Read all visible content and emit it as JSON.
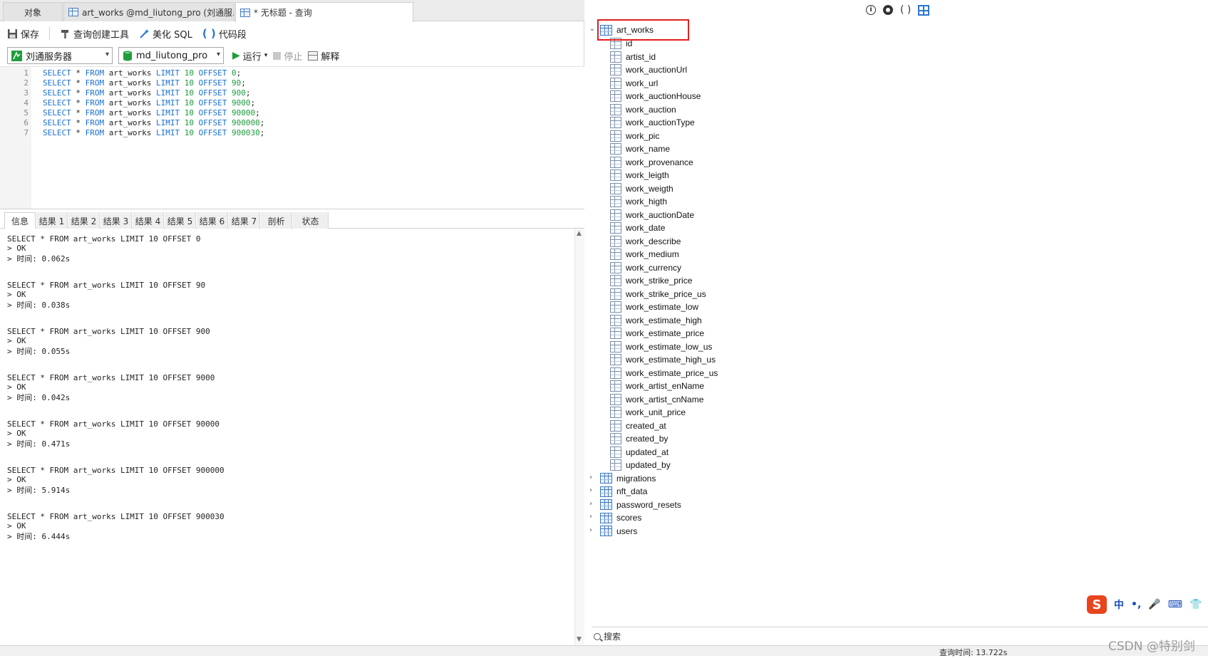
{
  "tabs": [
    {
      "label": "对象"
    },
    {
      "label": "art_works @md_liutong_pro (刘通服..."
    },
    {
      "label": "* 无标题 - 查询"
    }
  ],
  "toolbar": {
    "save": "保存",
    "query_builder": "查询创建工具",
    "beautify": "美化 SQL",
    "snippet": "代码段"
  },
  "toolbar2": {
    "server": "刘通服务器",
    "database": "md_liutong_pro",
    "run": "运行",
    "stop": "停止",
    "explain": "解释"
  },
  "editor": {
    "lines": [
      {
        "n": "1",
        "offset": "0"
      },
      {
        "n": "2",
        "offset": "90"
      },
      {
        "n": "3",
        "offset": "900"
      },
      {
        "n": "4",
        "offset": "9000"
      },
      {
        "n": "5",
        "offset": "90000"
      },
      {
        "n": "6",
        "offset": "900000"
      },
      {
        "n": "7",
        "offset": "900030"
      }
    ],
    "kw_select": "SELECT",
    "star": "*",
    "kw_from": "FROM",
    "table": "art_works",
    "kw_limit": "LIMIT",
    "limit": "10",
    "kw_offset": "OFFSET"
  },
  "result_tabs": [
    "信息",
    "结果 1",
    "结果 2",
    "结果 3",
    "结果 4",
    "结果 5",
    "结果 6",
    "结果 7",
    "剖析",
    "状态"
  ],
  "messages": [
    {
      "sql": "SELECT * FROM art_works LIMIT 10 OFFSET 0",
      "ok": "> OK",
      "time": "> 时间: 0.062s"
    },
    {
      "sql": "SELECT * FROM art_works LIMIT 10 OFFSET 90",
      "ok": "> OK",
      "time": "> 时间: 0.038s"
    },
    {
      "sql": "SELECT * FROM art_works LIMIT 10 OFFSET 900",
      "ok": "> OK",
      "time": "> 时间: 0.055s"
    },
    {
      "sql": "SELECT * FROM art_works LIMIT 10 OFFSET 9000",
      "ok": "> OK",
      "time": "> 时间: 0.042s"
    },
    {
      "sql": "SELECT * FROM art_works LIMIT 10 OFFSET 90000",
      "ok": "> OK",
      "time": "> 时间: 0.471s"
    },
    {
      "sql": "SELECT * FROM art_works LIMIT 10 OFFSET 900000",
      "ok": "> OK",
      "time": "> 时间: 5.914s"
    },
    {
      "sql": "SELECT * FROM art_works LIMIT 10 OFFSET 900030",
      "ok": "> OK",
      "time": "> 时间: 6.444s"
    }
  ],
  "tree": {
    "table": "art_works",
    "columns": [
      "id",
      "artist_id",
      "work_auctionUrl",
      "work_url",
      "work_auctionHouse",
      "work_auction",
      "work_auctionType",
      "work_pic",
      "work_name",
      "work_provenance",
      "work_leigth",
      "work_weigth",
      "work_higth",
      "work_auctionDate",
      "work_date",
      "work_describe",
      "work_medium",
      "work_currency",
      "work_strike_price",
      "work_strike_price_us",
      "work_estimate_low",
      "work_estimate_high",
      "work_estimate_price",
      "work_estimate_low_us",
      "work_estimate_high_us",
      "work_estimate_price_us",
      "work_artist_enName",
      "work_artist_cnName",
      "work_unit_price",
      "created_at",
      "created_by",
      "updated_at",
      "updated_by"
    ],
    "other_tables": [
      "migrations",
      "nft_data",
      "password_resets",
      "scores",
      "users"
    ]
  },
  "ime": {
    "s": "S",
    "lang": "中",
    "punct": "•,"
  },
  "search_placeholder": "搜索",
  "status_query_time": "查询时间: 13.722s",
  "watermark": "CSDN @特别剑"
}
